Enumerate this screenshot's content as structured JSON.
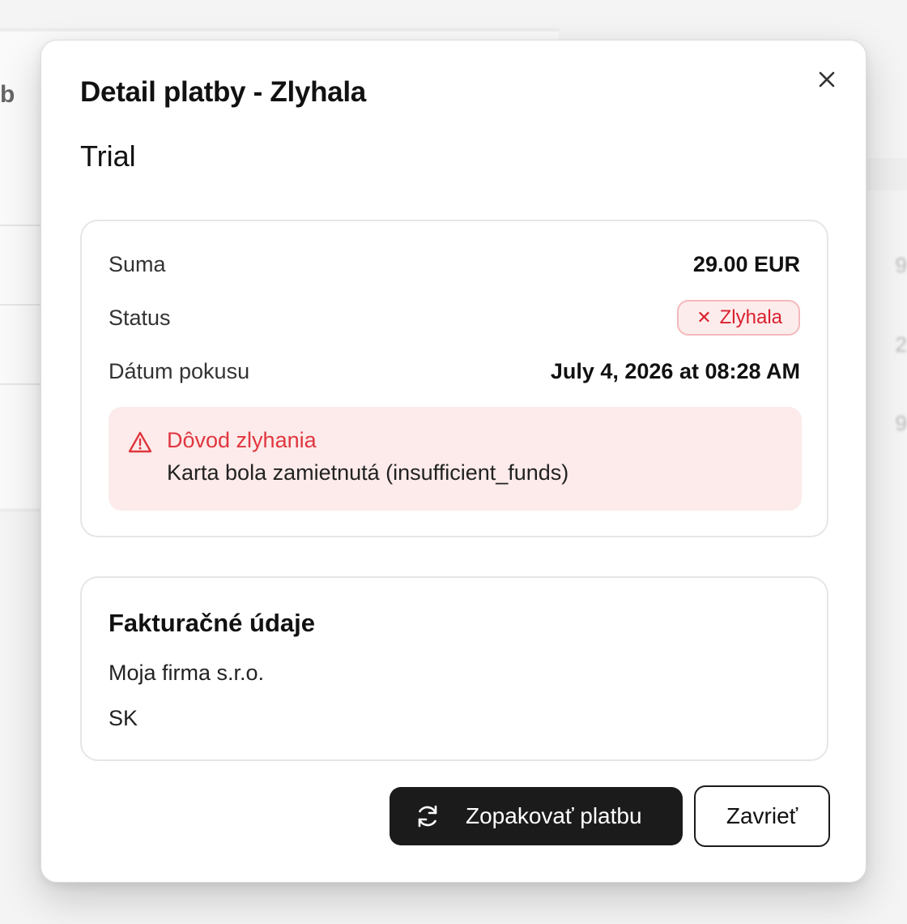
{
  "background": {
    "partial_text": "b",
    "digits": [
      "9",
      "2",
      "9"
    ]
  },
  "modal": {
    "title": "Detail platby - Zlyhala",
    "plan_name": "Trial",
    "close_icon": "close-icon"
  },
  "payment": {
    "amount_label": "Suma",
    "amount_value": "29.00 EUR",
    "status_label": "Status",
    "status_value": "Zlyhala",
    "status_icon": "x",
    "date_label": "Dátum pokusu",
    "date_value": "July 4, 2026 at 08:28 AM"
  },
  "failure": {
    "title": "Dôvod zlyhania",
    "message": "Karta bola zamietnutá (insufficient_funds)",
    "icon": "warning-triangle-icon"
  },
  "billing": {
    "title": "Fakturačné údaje",
    "company": "Moja firma s.r.o.",
    "country": "SK"
  },
  "actions": {
    "retry_label": "Zopakovať platbu",
    "retry_icon": "refresh-icon",
    "close_label": "Zavrieť"
  },
  "colors": {
    "error_red": "#e0363f",
    "badge_bg": "#fdecec",
    "error_bg": "#fcebea",
    "primary_button": "#1b1b1b"
  }
}
